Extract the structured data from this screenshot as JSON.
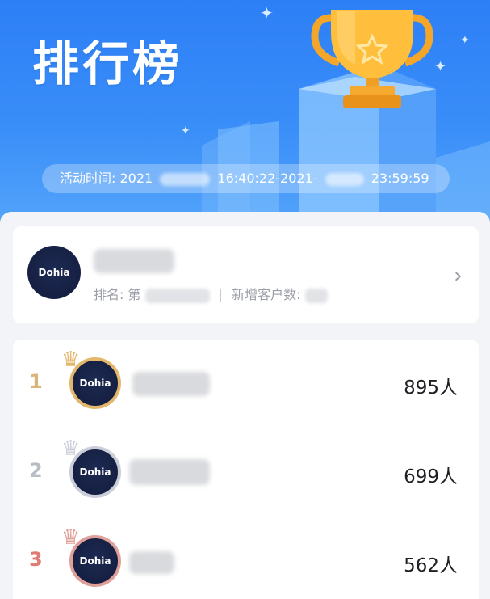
{
  "header": {
    "title": "排行榜",
    "activity_time_label": "活动时间:",
    "activity_start_year": "2021",
    "activity_time_middle": "16:40:22-2021-",
    "activity_end_time": "23:59:59"
  },
  "my_card": {
    "avatar_text": "Dohia",
    "rank_label": "排名: 第",
    "new_customers_label": "新增客户数:",
    "chevron": "›"
  },
  "leaderboard": {
    "rows": [
      {
        "rank": "1",
        "avatar_text": "Dohia",
        "count": "895人",
        "rank_color": "#d9b57c",
        "crown": "gold"
      },
      {
        "rank": "2",
        "avatar_text": "Dohia",
        "count": "699人",
        "rank_color": "#b8bcc4",
        "crown": "silver"
      },
      {
        "rank": "3",
        "avatar_text": "Dohia",
        "count": "562人",
        "rank_color": "#e07a72",
        "crown": "bronze"
      }
    ]
  },
  "colors": {
    "hero_blue": "#2d7ff6",
    "gold": "#e3b86d",
    "silver": "#c9ced8",
    "bronze": "#e0a09a"
  }
}
